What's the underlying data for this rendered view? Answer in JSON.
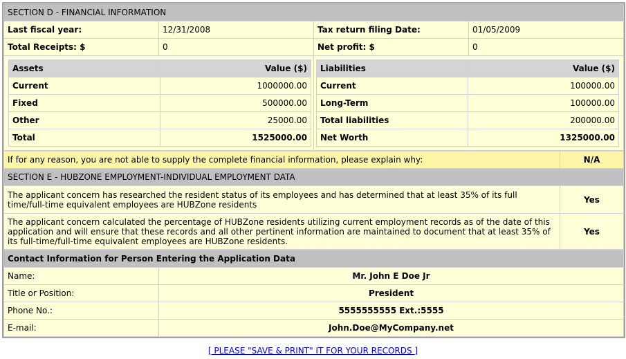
{
  "section_d": {
    "title": "SECTION D - FINANCIAL INFORMATION",
    "last_fiscal_year_label": "Last fiscal year:",
    "last_fiscal_year": "12/31/2008",
    "tax_return_label": "Tax return filing Date:",
    "tax_return": "01/05/2009",
    "total_receipts_label": "Total Receipts: $",
    "total_receipts": "0",
    "net_profit_label": "Net profit: $",
    "net_profit": "0",
    "assets": {
      "header": "Assets",
      "value_header": "Value ($)",
      "rows": [
        {
          "label": "Current",
          "value": "1000000.00"
        },
        {
          "label": "Fixed",
          "value": "500000.00"
        },
        {
          "label": "Other",
          "value": "25000.00"
        },
        {
          "label": "Total",
          "value": "1525000.00"
        }
      ]
    },
    "liabilities": {
      "header": "Liabilities",
      "value_header": "Value ($)",
      "rows": [
        {
          "label": "Current",
          "value": "100000.00"
        },
        {
          "label": "Long-Term",
          "value": "100000.00"
        },
        {
          "label": "Total liabilities",
          "value": "200000.00"
        },
        {
          "label": "Net Worth",
          "value": "1325000.00"
        }
      ]
    },
    "explain_label": "If for any reason, you are not able to supply the complete financial information, please explain why:",
    "explain_value": "N/A"
  },
  "section_e": {
    "title": "SECTION E - HUBZONE EMPLOYMENT-INDIVIDUAL EMPLOYMENT DATA",
    "rows": [
      {
        "text": "The applicant concern has researched the resident status of its employees and has determined that at least 35% of its full time/full-time equivalent employees are HUBZone residents",
        "value": "Yes"
      },
      {
        "text": "The applicant concern calculated the percentage of HUBZone residents utilizing current employment records as of the date of this application and will ensure that these records and all other pertinent information are maintained to document that at least 35% of its full-time/full-time equivalent employees are HUBZone residents.",
        "value": "Yes"
      }
    ]
  },
  "contact": {
    "title": "Contact Information for Person Entering the Application Data",
    "rows": [
      {
        "label": "Name:",
        "value": "Mr. John E Doe Jr"
      },
      {
        "label": "Title or Position:",
        "value": "President"
      },
      {
        "label": "Phone No.:",
        "value": "5555555555 Ext.:5555"
      },
      {
        "label": "E-mail:",
        "value": "John.Doe@MyCompany.net"
      }
    ]
  },
  "footer_link": "[ PLEASE \"SAVE & PRINT\" IT FOR YOUR RECORDS ]"
}
